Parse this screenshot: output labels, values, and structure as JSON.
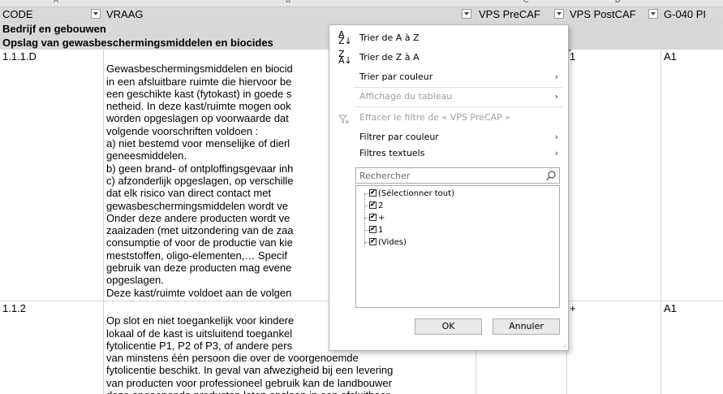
{
  "column_letters": [
    "A",
    "B",
    "C",
    "D"
  ],
  "header": {
    "code": "CODE",
    "vraag": "VRAAG",
    "vps_precap": "VPS PreCAF",
    "vps_postcap": "VPS PostCAF",
    "g040": "G-040 PI"
  },
  "sections": {
    "s1": "Bedrijf en gebouwen",
    "s2": "Opslag van gewasbeschermingsmiddelen en biocides"
  },
  "rows": [
    {
      "code": "1.1.1.D",
      "vraag": "Gewasbeschermingsmiddelen en biocid\nin een afsluitbare ruimte die hiervoor be\neen geschikte kast (fytokast) in goede s\nnetheid. In deze kast/ruimte mogen ook\nworden opgeslagen op voorwaarde dat\nvolgende voorschriften voldoen :\na) niet bestemd voor menselijke of dierl\ngeneesmiddelen.\nb) geen brand- of ontploffingsgevaar inh\nc) afzonderlijk opgeslagen, op verschille\ndat elk risico van direct contact met\ngewasbeschermingsmiddelen wordt ve\nOnder deze andere producten wordt ve\nzaaizaden (met uitzondering van de zaa\nconsumptie of voor de productie van kie\nmeststoffen, oligo-elementen,… Specif\ngebruik van deze producten mag evene\nopgeslagen.\nDeze kast/ruimte voldoet aan de volgen",
      "vps_post": "1",
      "g040": "A1"
    },
    {
      "code": "1.1.2",
      "vraag": "Op slot en niet toegankelijk voor kindere\nlokaal of de kast is uitsluitend toegankel\nfytolicentie P1, P2 of P3, of andere pers\nvan minstens één persoon die over de voorgenoemde\nfytolicentie beschikt. In geval van afwezigheid bij een levering\nvan producten voor professioneel gebruik kan de landbouwer\ndeze ongeopende producten laten opslaan in een afsluitbaar",
      "vps_post": "+",
      "g040": "A1"
    }
  ],
  "menu": {
    "sort_az": "Trier de A à Z",
    "sort_za": "Trier de Z à A",
    "sort_color": "Trier par couleur",
    "sheet_view": "Affichage du tableau",
    "clear_filter": "Effacer le filtre de « VPS PreCAP »",
    "filter_color": "Filtrer par couleur",
    "text_filters": "Filtres textuels",
    "search_placeholder": "Rechercher",
    "items": [
      "(Sélectionner tout)",
      "2",
      "+",
      "1",
      "(Vides)"
    ],
    "ok": "OK",
    "cancel": "Annuler"
  }
}
